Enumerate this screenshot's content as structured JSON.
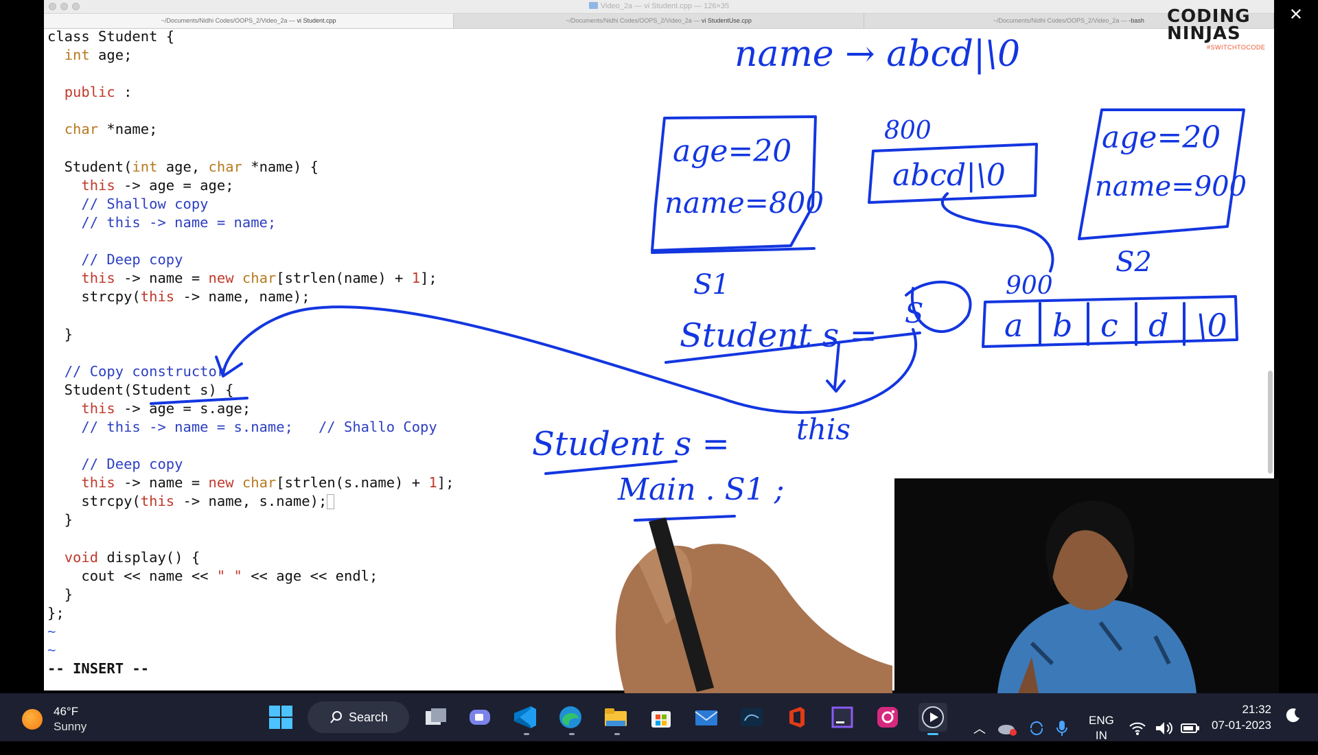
{
  "window": {
    "title": "Video_2a — vi Student.cpp — 126×35",
    "tabs": [
      {
        "path": "~/Documents/Nidhi Codes/OOPS_2/Video_2a — ",
        "cmd": "vi Student.cpp",
        "active": true
      },
      {
        "path": "~/Documents/Nidhi Codes/OOPS_2/Video_2a — ",
        "cmd": "vi StudentUse.cpp",
        "active": false
      },
      {
        "path": "~/Documents/Nidhi Codes/OOPS_2/Video_2a — ",
        "cmd": "-bash",
        "active": false
      }
    ]
  },
  "code_lines": [
    "class Student {",
    "  int age;",
    "",
    "  public :",
    "",
    "  char *name;",
    "",
    "  Student(int age, char *name) {",
    "    this -> age = age;",
    "    // Shallow copy",
    "    // this -> name = name;",
    "",
    "    // Deep copy",
    "    this -> name = new char[strlen(name) + 1];",
    "    strcpy(this -> name, name);",
    "",
    "  }",
    "",
    "  // Copy constructor",
    "  Student(Student s) {",
    "    this -> age = s.age;",
    "    // this -> name = s.name;   // Shallo Copy",
    "",
    "    // Deep copy",
    "    this -> name = new char[strlen(s.name) + 1];",
    "    strcpy(this -> name, s.name);",
    "  }",
    "",
    "  void display() {",
    "    cout << name << \" \" << age << endl;",
    "  }",
    "};",
    "~",
    "~",
    "-- INSERT --"
  ],
  "annotations": {
    "name_arrow": "name → abcd|\\0",
    "s1_box": [
      "age=20",
      "name=800"
    ],
    "addr_800": "800",
    "abcd_box": "abcd|\\0",
    "s2_box": [
      "age=20",
      "name=900"
    ],
    "s1_label": "S1",
    "s2_label": "S2",
    "addr_900": "900",
    "array_cells": [
      "a",
      "b",
      "c",
      "d",
      "\\0"
    ],
    "student_s_decl": "Student s =",
    "s_circled": "S",
    "this_label": "this",
    "student_s_expr": "Student s =",
    "main_s1": "Main . S1 ;"
  },
  "brand": {
    "line1": "CODING",
    "line2": "NINJAS",
    "tagline": "#SWITCHTOCODE",
    "accent": "#e8552f"
  },
  "taskbar": {
    "weather_temp": "46°F",
    "weather_cond": "Sunny",
    "search_label": "Search",
    "language": [
      "ENG",
      "IN"
    ],
    "time": "21:32",
    "date": "07-01-2023",
    "background": "#1c2030"
  },
  "ink_color": "#1336e0"
}
